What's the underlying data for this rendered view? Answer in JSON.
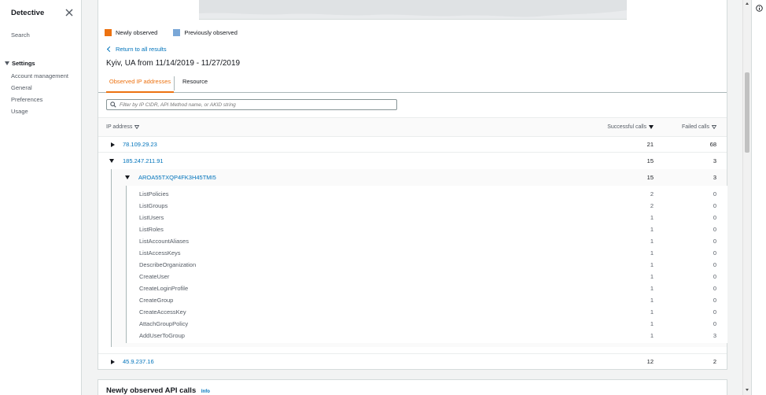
{
  "sidebar": {
    "title": "Detective",
    "search": "Search",
    "settings_label": "Settings",
    "items": [
      {
        "label": "Account management"
      },
      {
        "label": "General"
      },
      {
        "label": "Preferences"
      },
      {
        "label": "Usage"
      }
    ]
  },
  "legend": {
    "newly_label": "Newly observed",
    "previously_label": "Previously observed",
    "newly_color": "#ec7211",
    "previously_color": "#7aa7d7"
  },
  "back_link": "Return to all results",
  "heading": "Kyiv, UA from 11/14/2019 - 11/27/2019",
  "tabs": [
    {
      "label": "Observed IP addresses",
      "active": true
    },
    {
      "label": "Resource",
      "active": false
    }
  ],
  "filter": {
    "placeholder": "Filter by IP CIDR, API Method name, or AKID string"
  },
  "table": {
    "col_ip": "IP address",
    "col_success": "Successful calls",
    "col_failed": "Failed calls",
    "rows": [
      {
        "ip": "78.109.29.23",
        "success": "21",
        "failed": "68"
      },
      {
        "ip": "185.247.211.91",
        "success": "15",
        "failed": "3"
      },
      {
        "ip": "45.9.237.16",
        "success": "12",
        "failed": "2"
      }
    ],
    "akid": {
      "id": "AROA55TXQP4FK3H45TMI5",
      "success": "15",
      "failed": "3"
    },
    "api_calls": [
      {
        "name": "ListPolicies",
        "success": "2",
        "failed": "0"
      },
      {
        "name": "ListGroups",
        "success": "2",
        "failed": "0"
      },
      {
        "name": "ListUsers",
        "success": "1",
        "failed": "0"
      },
      {
        "name": "ListRoles",
        "success": "1",
        "failed": "0"
      },
      {
        "name": "ListAccountAliases",
        "success": "1",
        "failed": "0"
      },
      {
        "name": "ListAccessKeys",
        "success": "1",
        "failed": "0"
      },
      {
        "name": "DescribeOrganization",
        "success": "1",
        "failed": "0"
      },
      {
        "name": "CreateUser",
        "success": "1",
        "failed": "0"
      },
      {
        "name": "CreateLoginProfile",
        "success": "1",
        "failed": "0"
      },
      {
        "name": "CreateGroup",
        "success": "1",
        "failed": "0"
      },
      {
        "name": "CreateAccessKey",
        "success": "1",
        "failed": "0"
      },
      {
        "name": "AttachGroupPolicy",
        "success": "1",
        "failed": "0"
      },
      {
        "name": "AddUserToGroup",
        "success": "1",
        "failed": "3"
      }
    ]
  },
  "second_panel": {
    "title": "Newly observed API calls",
    "info": "Info"
  }
}
